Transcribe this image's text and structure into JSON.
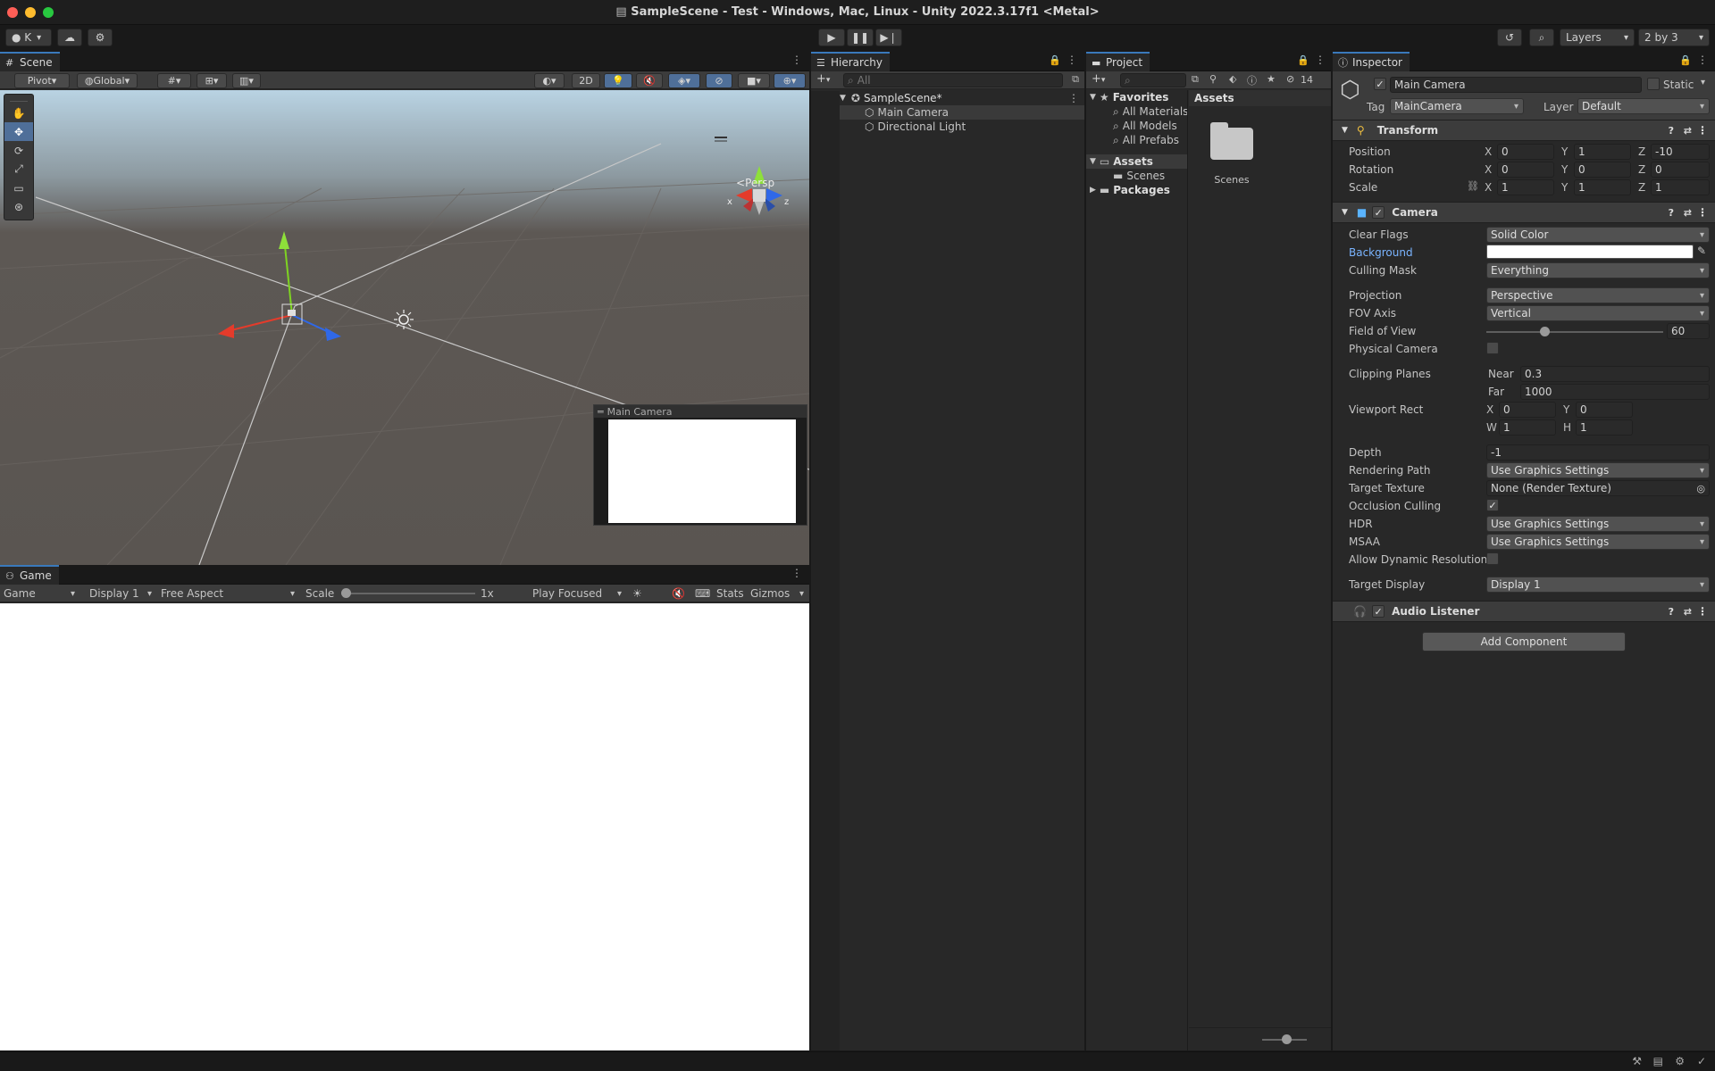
{
  "window": {
    "title": "SampleScene - Test - Windows, Mac, Linux - Unity 2022.3.17f1 <Metal>"
  },
  "toolbar": {
    "account_label": "K",
    "layers_label": "Layers",
    "layout_label": "2 by 3"
  },
  "scene": {
    "tab_label": "Scene",
    "pivot_label": "Pivot",
    "global_label": "Global",
    "mode_2d_label": "2D",
    "persp_label": "Persp",
    "gizmo_x": "x",
    "gizmo_z": "z",
    "camera_preview_title": "Main Camera"
  },
  "game": {
    "tab_label": "Game",
    "view_label": "Game",
    "display_label": "Display 1",
    "aspect_label": "Free Aspect",
    "scale_label": "Scale",
    "scale_value": "1x",
    "play_mode_label": "Play Focused",
    "stats_label": "Stats",
    "gizmos_label": "Gizmos"
  },
  "hierarchy": {
    "tab_label": "Hierarchy",
    "search_placeholder": "All",
    "scene_name": "SampleScene*",
    "items": [
      "Main Camera",
      "Directional Light"
    ]
  },
  "project": {
    "tab_label": "Project",
    "badge_count": "14",
    "favorites_label": "Favorites",
    "favorites": [
      "All Materials",
      "All Models",
      "All Prefabs"
    ],
    "assets_label": "Assets",
    "asset_children": [
      "Scenes"
    ],
    "packages_label": "Packages",
    "breadcrumb": "Assets",
    "grid_items": [
      "Scenes"
    ]
  },
  "inspector": {
    "tab_label": "Inspector",
    "object_name": "Main Camera",
    "static_label": "Static",
    "tag_label": "Tag",
    "tag_value": "MainCamera",
    "layer_label": "Layer",
    "layer_value": "Default",
    "transform": {
      "title": "Transform",
      "position_label": "Position",
      "rotation_label": "Rotation",
      "scale_label": "Scale",
      "position": {
        "x": "0",
        "y": "1",
        "z": "-10"
      },
      "rotation": {
        "x": "0",
        "y": "0",
        "z": "0"
      },
      "scale": {
        "x": "1",
        "y": "1",
        "z": "1"
      }
    },
    "camera": {
      "title": "Camera",
      "clear_flags_label": "Clear Flags",
      "clear_flags_value": "Solid Color",
      "background_label": "Background",
      "background_color": "#ffffff",
      "culling_mask_label": "Culling Mask",
      "culling_mask_value": "Everything",
      "projection_label": "Projection",
      "projection_value": "Perspective",
      "fov_axis_label": "FOV Axis",
      "fov_axis_value": "Vertical",
      "fov_label": "Field of View",
      "fov_value": "60",
      "fov_fraction": 0.33,
      "physical_camera_label": "Physical Camera",
      "clipping_label": "Clipping Planes",
      "near_label": "Near",
      "near_value": "0.3",
      "far_label": "Far",
      "far_value": "1000",
      "viewport_label": "Viewport Rect",
      "viewport": {
        "x": "0",
        "y": "0",
        "w": "1",
        "h": "1"
      },
      "depth_label": "Depth",
      "depth_value": "-1",
      "rendering_path_label": "Rendering Path",
      "rendering_path_value": "Use Graphics Settings",
      "target_texture_label": "Target Texture",
      "target_texture_value": "None (Render Texture)",
      "occlusion_label": "Occlusion Culling",
      "hdr_label": "HDR",
      "hdr_value": "Use Graphics Settings",
      "msaa_label": "MSAA",
      "msaa_value": "Use Graphics Settings",
      "dynamic_res_label": "Allow Dynamic Resolution",
      "target_display_label": "Target Display",
      "target_display_value": "Display 1"
    },
    "audio_listener_title": "Audio Listener",
    "add_component_label": "Add Component"
  },
  "colors": {
    "accent": "#3a79bb",
    "link_blue": "#7ab4ff",
    "scene_sky_top": "#b9d3e3",
    "scene_ground": "#5d5854",
    "game_view": "#ffffff"
  }
}
